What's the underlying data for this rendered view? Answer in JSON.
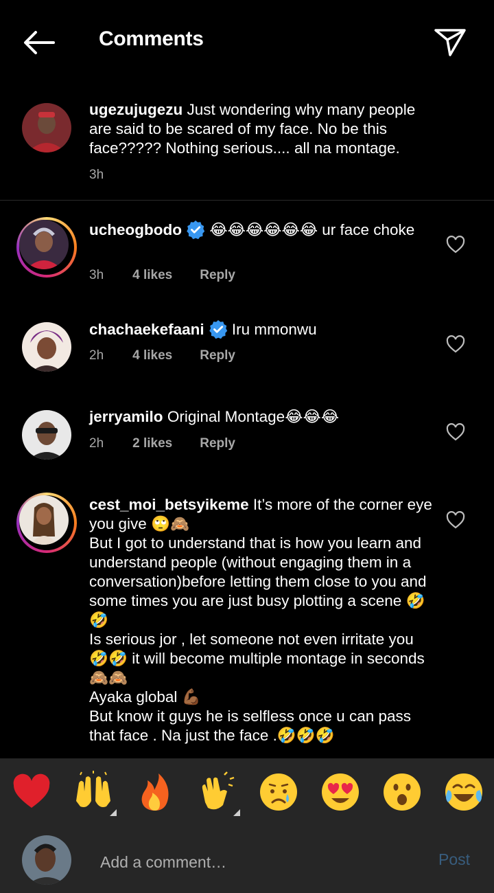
{
  "header": {
    "title": "Comments",
    "back_icon": "back-arrow-icon",
    "share_icon": "send-icon"
  },
  "caption": {
    "username": "ugezujugezu",
    "text": "Just wondering why many people are said to be scared of my face. No be this face????? Nothing serious.... all na  montage.",
    "time": "3h"
  },
  "comments": [
    {
      "username": "ucheogbodo",
      "verified": true,
      "text": "😂😂😂😂😂😂 ur face choke",
      "time": "3h",
      "likes": "4 likes",
      "reply": "Reply",
      "has_story": true
    },
    {
      "username": "chachaekefaani",
      "verified": true,
      "text": "Iru mmonwu",
      "time": "2h",
      "likes": "4 likes",
      "reply": "Reply",
      "has_story": false
    },
    {
      "username": "jerryamilo",
      "verified": false,
      "text": "Original Montage😂😂😂",
      "time": "2h",
      "likes": "2 likes",
      "reply": "Reply",
      "has_story": false
    },
    {
      "username": "cest_moi_betsyikeme",
      "verified": false,
      "text_lines": [
        "It’s more of the corner eye you give 🙄🙈",
        "But I got to understand that is how you learn and understand people (without engaging them in a conversation)before letting them close to you and some times you are just busy plotting a scene 🤣🤣",
        "Is serious jor , let someone not even irritate you 🤣🤣 it will become multiple montage in seconds 🙈🙈",
        "Ayaka global 💪🏾",
        "But know it guys he is selfless once u can pass that face . Na just the face .🤣🤣🤣"
      ],
      "has_story": true
    }
  ],
  "quick_reactions": [
    "❤️",
    "🙌",
    "🔥",
    "👏",
    "😢",
    "😍",
    "😮",
    "😂"
  ],
  "composer": {
    "placeholder": "Add a comment…",
    "post_label": "Post"
  },
  "colors": {
    "background": "#000000",
    "sheet": "#262626",
    "verified": "#3897f0",
    "post_disabled": "#385d7e",
    "meta": "#a8a8a8"
  }
}
